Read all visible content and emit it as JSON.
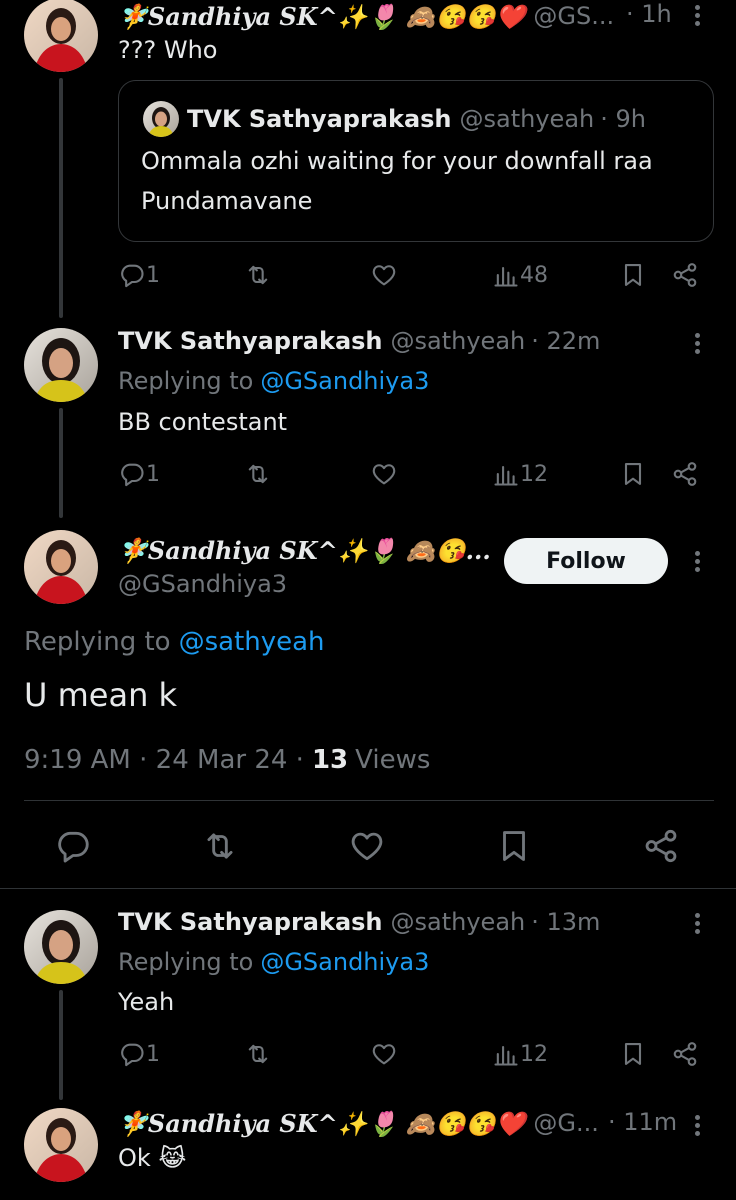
{
  "tweet1": {
    "name": "🧚Sandhiya SK^✨🌷 🙈😘😘❤️",
    "handle": "@GS...",
    "time": "· 1h",
    "text": "??? Who",
    "quote": {
      "name": "TVK Sathyaprakash",
      "handle": "@sathyeah",
      "time": "· 9h",
      "text_line1": "Ommala ozhi waiting for your downfall raa",
      "text_line2": "Pundamavane"
    },
    "replies": "1",
    "views": "48"
  },
  "tweet2": {
    "name": "TVK Sathyaprakash",
    "handle": "@sathyeah",
    "time": "· 22m",
    "replying_prefix": "Replying to",
    "replying_to": "@GSandhiya3",
    "text": "BB contestant",
    "replies": "1",
    "views": "12"
  },
  "main_tweet": {
    "name": "🧚Sandhiya SK^✨🌷 🙈😘...",
    "handle": "@GSandhiya3",
    "follow_label": "Follow",
    "replying_prefix": "Replying to",
    "replying_to": "@sathyeah",
    "text": "U mean k",
    "timestamp": "9:19 AM · 24 Mar 24 ·",
    "views_count": "13",
    "views_label": "Views"
  },
  "tweet3": {
    "name": "TVK Sathyaprakash",
    "handle": "@sathyeah",
    "time": "· 13m",
    "replying_prefix": "Replying to",
    "replying_to": "@GSandhiya3",
    "text": "Yeah",
    "replies": "1",
    "views": "12"
  },
  "tweet4": {
    "name": "🧚Sandhiya SK^✨🌷 🙈😘😘❤️",
    "handle": "@G...",
    "time": "· 11m",
    "text": "Ok 😹"
  },
  "icons": [
    "reply-icon",
    "retweet-icon",
    "like-icon",
    "views-icon",
    "bookmark-icon",
    "share-icon",
    "more-icon"
  ],
  "colors": {
    "background": "#000000",
    "text": "#e7e9ea",
    "muted": "#71767b",
    "link": "#1d9bf0"
  }
}
